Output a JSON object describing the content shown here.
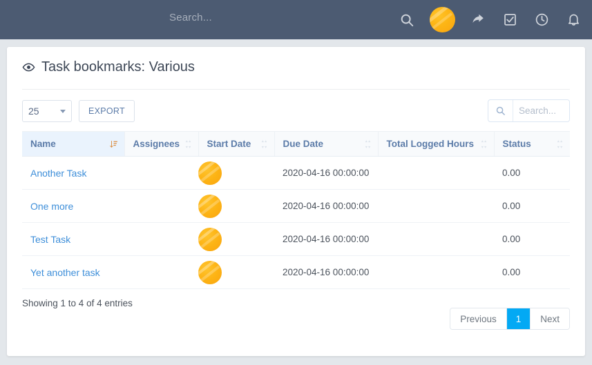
{
  "navbar": {
    "search_placeholder": "Search...",
    "icons": [
      {
        "name": "search-icon"
      },
      {
        "name": "user-avatar"
      },
      {
        "name": "share-icon"
      },
      {
        "name": "checkbox-checked-icon"
      },
      {
        "name": "clock-icon"
      },
      {
        "name": "bell-icon"
      }
    ],
    "bg_color": "#4c5b72"
  },
  "page": {
    "title": "Task bookmarks: Various",
    "title_icon": "eye-icon"
  },
  "toolbar": {
    "page_length": "25",
    "page_length_options": [
      "25"
    ],
    "export_label": "EXPORT",
    "search_placeholder": "Search...",
    "search_value": ""
  },
  "table": {
    "columns": [
      {
        "label": "Name",
        "sorted": true,
        "sort_dir": "asc"
      },
      {
        "label": "Assignees",
        "sorted": false
      },
      {
        "label": "Start Date",
        "sorted": false
      },
      {
        "label": "Due Date",
        "sorted": false
      },
      {
        "label": "Total Logged Hours",
        "sorted": false
      },
      {
        "label": "Status",
        "sorted": false
      }
    ],
    "rows": [
      {
        "name": "Another Task",
        "assignee_avatar": true,
        "start_date": "",
        "due_date": "2020-04-16 00:00:00",
        "total_logged_hours": "",
        "status": "0.00"
      },
      {
        "name": "One more",
        "assignee_avatar": true,
        "start_date": "",
        "due_date": "2020-04-16 00:00:00",
        "total_logged_hours": "",
        "status": "0.00"
      },
      {
        "name": "Test Task",
        "assignee_avatar": true,
        "start_date": "",
        "due_date": "2020-04-16 00:00:00",
        "total_logged_hours": "",
        "status": "0.00"
      },
      {
        "name": "Yet another task",
        "assignee_avatar": true,
        "start_date": "",
        "due_date": "2020-04-16 00:00:00",
        "total_logged_hours": "",
        "status": "0.00"
      }
    ]
  },
  "footer": {
    "showing": "Showing 1 to 4 of 4 entries",
    "previous_label": "Previous",
    "current_page": "1",
    "next_label": "Next",
    "active_page_color": "#03a9f4"
  }
}
